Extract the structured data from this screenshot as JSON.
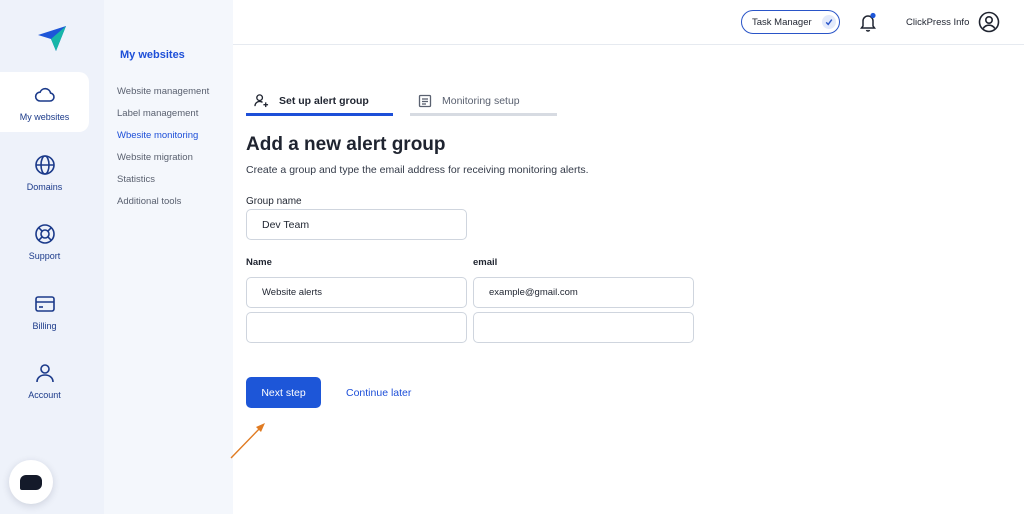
{
  "rail": {
    "items": [
      {
        "label": "My websites",
        "icon": "cloud-icon",
        "active": true
      },
      {
        "label": "Domains",
        "icon": "globe-icon"
      },
      {
        "label": "Support",
        "icon": "lifebuoy-icon"
      },
      {
        "label": "Billing",
        "icon": "credit-card-icon"
      },
      {
        "label": "Account",
        "icon": "user-icon"
      }
    ]
  },
  "subnav": {
    "title": "My websites",
    "items": [
      {
        "label": "Website management"
      },
      {
        "label": "Label management"
      },
      {
        "label": "Wbesite monitoring",
        "active": true
      },
      {
        "label": "Website migration"
      },
      {
        "label": "Statistics"
      },
      {
        "label": "Additional tools"
      }
    ]
  },
  "topbar": {
    "task_manager_label": "Task Manager",
    "user_name": "ClickPress Info"
  },
  "tabs": [
    {
      "label": "Set up alert group",
      "active": true
    },
    {
      "label": "Monitoring setup"
    }
  ],
  "form": {
    "heading": "Add a new alert group",
    "subheading": "Create a group and type the email address for receiving monitoring alerts.",
    "group_name_label": "Group name",
    "group_name_value": "Dev Team",
    "name_col_label": "Name",
    "email_col_label": "email",
    "rows": [
      {
        "name": "Website alerts",
        "email": "example@gmail.com"
      },
      {
        "name": "",
        "email": ""
      }
    ],
    "next_label": "Next step",
    "later_label": "Continue later"
  },
  "colors": {
    "accent": "#1d56d8",
    "rail_bg": "#eef2fa",
    "annotation_arrow": "#e07b22"
  }
}
